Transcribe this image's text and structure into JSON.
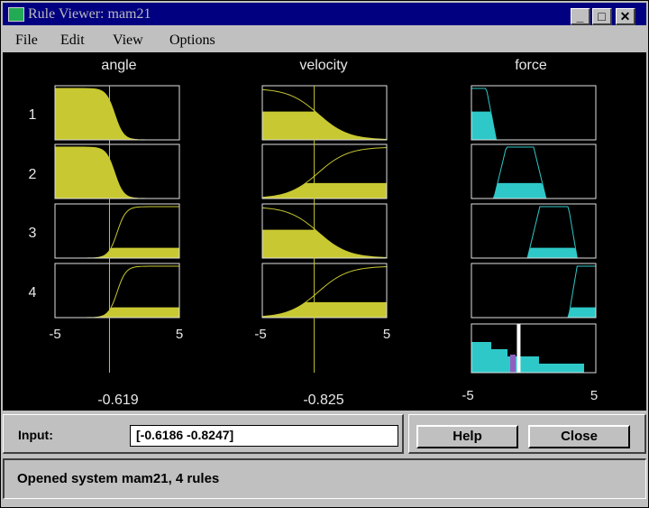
{
  "window": {
    "title": "Rule Viewer: mam21"
  },
  "window_controls": {
    "minimize": "_",
    "maximize": "□",
    "close": "✕"
  },
  "menu": [
    "File",
    "Edit",
    "View",
    "Options"
  ],
  "variables": {
    "angle": {
      "label": "angle",
      "range_min": "-5",
      "range_max": "5",
      "value_label": "-0.619",
      "value": -0.6186
    },
    "velocity": {
      "label": "velocity",
      "range_min": "-5",
      "range_max": "5",
      "value_label": "-0.825",
      "value": -0.8247
    },
    "force": {
      "label": "force",
      "range_min": "-5",
      "range_max": "5",
      "output_value": -1.2
    }
  },
  "rules": [
    "1",
    "2",
    "3",
    "4"
  ],
  "input": {
    "label": "Input:",
    "value": "[-0.6186 -0.8247]"
  },
  "buttons": {
    "help": "Help",
    "close": "Close"
  },
  "status": {
    "text": "Opened system mam21, 4 rules"
  },
  "colors": {
    "input_fill": "#c8c832",
    "output_fill": "#2ec8c8",
    "marker": "#c8c832",
    "centroid": "#ffffff",
    "accent": "#9060c0"
  }
}
